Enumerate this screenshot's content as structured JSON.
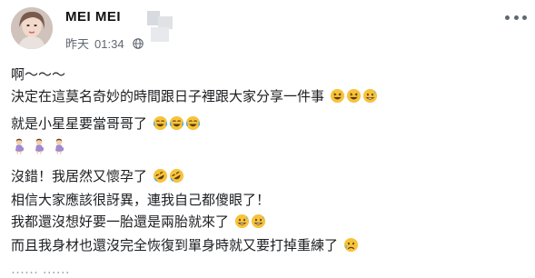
{
  "post": {
    "author": "MEI MEI",
    "date": "昨天",
    "time": "01:34",
    "lines": [
      "啊～～～",
      "決定在這莫名奇妙的時間跟日子裡跟大家分享一件事",
      "就是小星星要當哥哥了",
      "",
      "沒錯！我居然又懷孕了",
      "相信大家應該很訝異，連我自己都傻眼了！",
      "我都還沒想好要一胎還是兩胎就來了",
      "而且我身材也還沒完全恢復到單身時就又要打掉重練了",
      "…… ……"
    ],
    "line_emojis": [
      [
        "laughing-emoji",
        "laughing-emoji",
        "grinning-sweat-emoji"
      ],
      [
        "tears-of-joy-emoji",
        "tears-of-joy-emoji",
        "tears-of-joy-emoji"
      ],
      [
        "pregnant-woman-emoji",
        "pregnant-woman-emoji",
        "pregnant-woman-emoji"
      ],
      [
        "rolling-laugh-emoji",
        "rolling-laugh-emoji"
      ],
      [
        "grinning-sweat-emoji",
        "grinning-sweat-emoji"
      ],
      [
        "sad-emoji"
      ]
    ]
  },
  "icons": {
    "globe": "globe-icon",
    "more": "more-options-icon"
  },
  "colors": {
    "text": "#1c1e21",
    "meta": "#606770",
    "emoji_face": "#f7c33b"
  }
}
